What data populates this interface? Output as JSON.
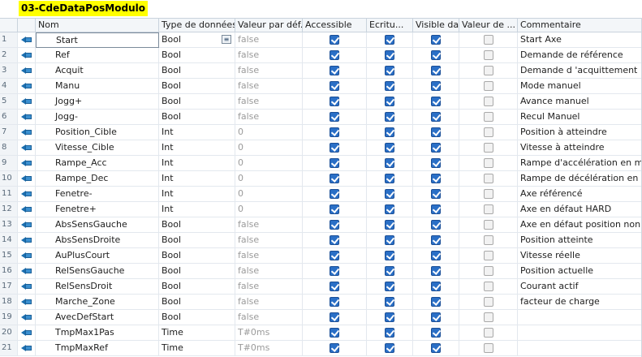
{
  "title": "03-CdeDataPosModulo",
  "columns": {
    "name": "Nom",
    "type": "Type de données",
    "default": "Valeur par déf.",
    "accessible": "Accessible",
    "ecriture": "Ecritu...",
    "visible": "Visible da",
    "valeur_de": "Valeur de ...",
    "comment": "Commentaire"
  },
  "rows": [
    {
      "num": "1",
      "name": "Start",
      "type": "Bool",
      "default": "false",
      "accessible": true,
      "ecriture": true,
      "visible": true,
      "valeur_de": false,
      "comment": "Start Axe"
    },
    {
      "num": "2",
      "name": "Ref",
      "type": "Bool",
      "default": "false",
      "accessible": true,
      "ecriture": true,
      "visible": true,
      "valeur_de": false,
      "comment": "Demande de référence"
    },
    {
      "num": "3",
      "name": "Acquit",
      "type": "Bool",
      "default": "false",
      "accessible": true,
      "ecriture": true,
      "visible": true,
      "valeur_de": false,
      "comment": "Demande d 'acquittement"
    },
    {
      "num": "4",
      "name": "Manu",
      "type": "Bool",
      "default": "false",
      "accessible": true,
      "ecriture": true,
      "visible": true,
      "valeur_de": false,
      "comment": "Mode manuel"
    },
    {
      "num": "5",
      "name": "Jogg+",
      "type": "Bool",
      "default": "false",
      "accessible": true,
      "ecriture": true,
      "visible": true,
      "valeur_de": false,
      "comment": "Avance manuel"
    },
    {
      "num": "6",
      "name": "Jogg-",
      "type": "Bool",
      "default": "false",
      "accessible": true,
      "ecriture": true,
      "visible": true,
      "valeur_de": false,
      "comment": "Recul Manuel"
    },
    {
      "num": "7",
      "name": "Position_Cible",
      "type": "Int",
      "default": "0",
      "accessible": true,
      "ecriture": true,
      "visible": true,
      "valeur_de": false,
      "comment": "Position à atteindre"
    },
    {
      "num": "8",
      "name": "Vitesse_Cible",
      "type": "Int",
      "default": "0",
      "accessible": true,
      "ecriture": true,
      "visible": true,
      "valeur_de": false,
      "comment": "Vitesse à atteindre"
    },
    {
      "num": "9",
      "name": "Rampe_Acc",
      "type": "Int",
      "default": "0",
      "accessible": true,
      "ecriture": true,
      "visible": true,
      "valeur_de": false,
      "comment": "Rampe d'accélération en ms"
    },
    {
      "num": "10",
      "name": "Rampe_Dec",
      "type": "Int",
      "default": "0",
      "accessible": true,
      "ecriture": true,
      "visible": true,
      "valeur_de": false,
      "comment": "Rampe de décélération en ms"
    },
    {
      "num": "11",
      "name": "Fenetre-",
      "type": "Int",
      "default": "0",
      "accessible": true,
      "ecriture": true,
      "visible": true,
      "valeur_de": false,
      "comment": "Axe référencé"
    },
    {
      "num": "12",
      "name": "Fenetre+",
      "type": "Int",
      "default": "0",
      "accessible": true,
      "ecriture": true,
      "visible": true,
      "valeur_de": false,
      "comment": "Axe en défaut HARD"
    },
    {
      "num": "13",
      "name": "AbsSensGauche",
      "type": "Bool",
      "default": "false",
      "accessible": true,
      "ecriture": true,
      "visible": true,
      "valeur_de": false,
      "comment": "Axe en défaut position non atteinte"
    },
    {
      "num": "14",
      "name": "AbsSensDroite",
      "type": "Bool",
      "default": "false",
      "accessible": true,
      "ecriture": true,
      "visible": true,
      "valeur_de": false,
      "comment": "Position atteinte"
    },
    {
      "num": "15",
      "name": "AuPlusCourt",
      "type": "Bool",
      "default": "false",
      "accessible": true,
      "ecriture": true,
      "visible": true,
      "valeur_de": false,
      "comment": "Vitesse réelle"
    },
    {
      "num": "16",
      "name": "RelSensGauche",
      "type": "Bool",
      "default": "false",
      "accessible": true,
      "ecriture": true,
      "visible": true,
      "valeur_de": false,
      "comment": "Position actuelle"
    },
    {
      "num": "17",
      "name": "RelSensDroit",
      "type": "Bool",
      "default": "false",
      "accessible": true,
      "ecriture": true,
      "visible": true,
      "valeur_de": false,
      "comment": "Courant actif"
    },
    {
      "num": "18",
      "name": "Marche_Zone",
      "type": "Bool",
      "default": "false",
      "accessible": true,
      "ecriture": true,
      "visible": true,
      "valeur_de": false,
      "comment": "facteur de charge"
    },
    {
      "num": "19",
      "name": "AvecDefStart",
      "type": "Bool",
      "default": "false",
      "accessible": true,
      "ecriture": true,
      "visible": true,
      "valeur_de": false,
      "comment": ""
    },
    {
      "num": "20",
      "name": "TmpMax1Pas",
      "type": "Time",
      "default": "T#0ms",
      "accessible": true,
      "ecriture": true,
      "visible": true,
      "valeur_de": false,
      "comment": ""
    },
    {
      "num": "21",
      "name": "TmpMaxRef",
      "type": "Time",
      "default": "T#0ms",
      "accessible": true,
      "ecriture": true,
      "visible": true,
      "valeur_de": false,
      "comment": ""
    }
  ],
  "colors": {
    "title_bg": "#ffff00",
    "checked": "#2a6fc6",
    "interface_icon": "#3a8fd0"
  },
  "icons": {
    "row_icon": "input-interface-icon",
    "type_button": "datatype-picker-icon"
  }
}
